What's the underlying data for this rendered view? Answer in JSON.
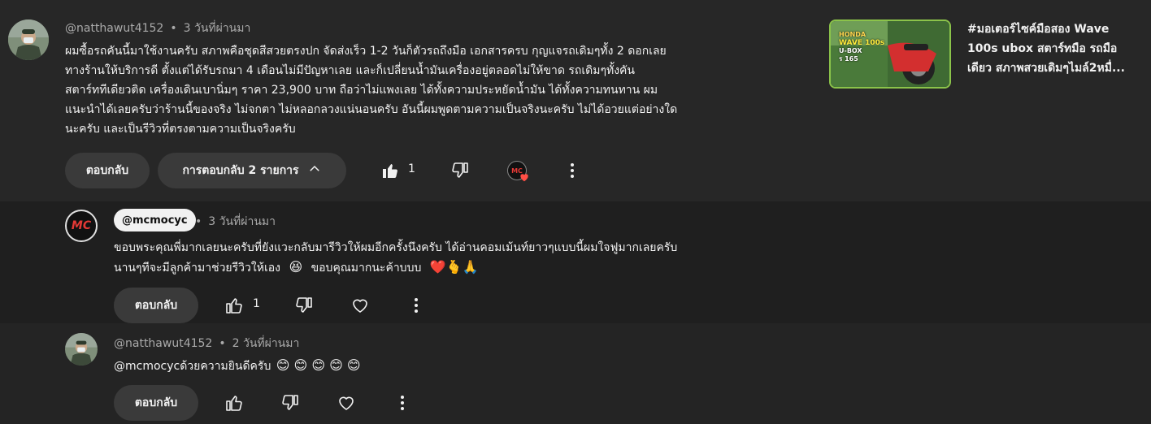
{
  "main_comment": {
    "author": "@natthawut4152",
    "time": "3 วันที่ผ่านมา",
    "lines": [
      "ผมซื้อรถคันนี้มาใช้งานครับ สภาพคือชุดสีสวยตรงปก จัดส่งเร็ว 1-2 วันก็ตัวรถถึงมือ เอกสารครบ กุญแจรถเดิมๆทั้ง 2 ดอกเลย",
      "ทางร้านให้บริการดี ตั้งแต่ได้รับรถมา 4 เดือนไม่มีปัญหาเลย และก็เปลี่ยนน้ำมันเครื่องอยู่ตลอดไม่ให้ขาด รถเดิมๆทั้งคัน",
      "สตาร์ททีเดียวติด เครื่องเดินเบานิ่มๆ ราคา 23,900 บาท ถือว่าไม่แพงเลย ได้ทั้งความประหยัดน้ำมัน ได้ทั้งความทนทาน ผม",
      "แนะนำได้เลยครับว่าร้านนี้ของจริง ไม่จกตา ไม่หลอกลวงแน่นอนครับ อันนี้ผมพูดตามความเป็นจริงนะครับ ไม่ได้อวยแต่อย่างใด",
      "นะครับ และเป็นรีวิวที่ตรงตามความเป็นจริงครับ"
    ],
    "reply_label": "ตอบกลับ",
    "replies_toggle": "การตอบกลับ 2 รายการ",
    "like_count": "1",
    "creator_heart_badge": "MC"
  },
  "video_card": {
    "title": "#มอเตอร์ไซค์มือสอง Wave 100s ubox สตาร์ทมือ รถมือเดียว สภาพสวยเดิมๆไมล์2หมื่...",
    "thumb_text_1": "HONDA",
    "thumb_text_2": "WAVE 100s",
    "thumb_text_3": "U-BOX",
    "thumb_text_4": "ร 165"
  },
  "reply1": {
    "author": "@mcmocyc",
    "avatar_text": "MC",
    "time": "3 วันที่ผ่านมา",
    "line1": "ขอบพระคุณพี่มากเลยนะครับที่ยังแวะกลับมารีวิวให้ผมอีกครั้งนึงครับ ได้อ่านคอมเม้นท์ยาวๆแบบนี้ผมใจฟูมากเลยครับ",
    "line2_text": "นานๆทีจะมีลูกค้ามาช่วยรีวิวให้เอง",
    "line2_emoji1": "😆",
    "line2_text2": "ขอบคุณมากนะค้าบบบ",
    "line2_emoji2": "❤️🫰🙏",
    "reply_label": "ตอบกลับ",
    "like_count": "1"
  },
  "reply2": {
    "author": "@natthawut4152",
    "time": "2 วันที่ผ่านมา",
    "text": "@mcmocycด้วยความยินดีครับ",
    "emojis": "😊 😊 😊 😊 😊",
    "reply_label": "ตอบกลับ"
  },
  "colors": {
    "background": "#212121",
    "heart": "#ff4e45",
    "badge_red": "#e53935",
    "thumb_green": "#8bc34a"
  }
}
